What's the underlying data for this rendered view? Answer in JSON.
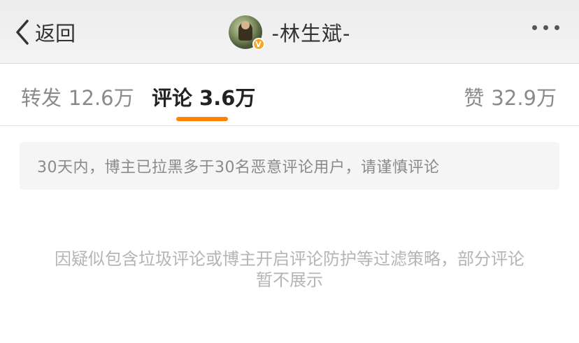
{
  "header": {
    "back_label": "返回",
    "title": "-林生斌-",
    "verified_badge": "V"
  },
  "tabs": [
    {
      "label": "转发",
      "count": "12.6万",
      "active": false
    },
    {
      "label": "评论",
      "count": "3.6万",
      "active": true
    },
    {
      "label": "赞",
      "count": "32.9万",
      "active": false
    }
  ],
  "notice": {
    "text": "30天内，博主已拉黑多于30名恶意评论用户，请谨慎评论"
  },
  "policy_message": {
    "line1": "因疑似包含垃圾评论或博主开启评论防护等过滤策略，部分评论",
    "line2": "暂不展示"
  },
  "colors": {
    "accent": "#ff8200",
    "badge": "#f6a623"
  },
  "icons": {
    "back": "chevron-left-icon",
    "more": "more-dots-icon"
  }
}
